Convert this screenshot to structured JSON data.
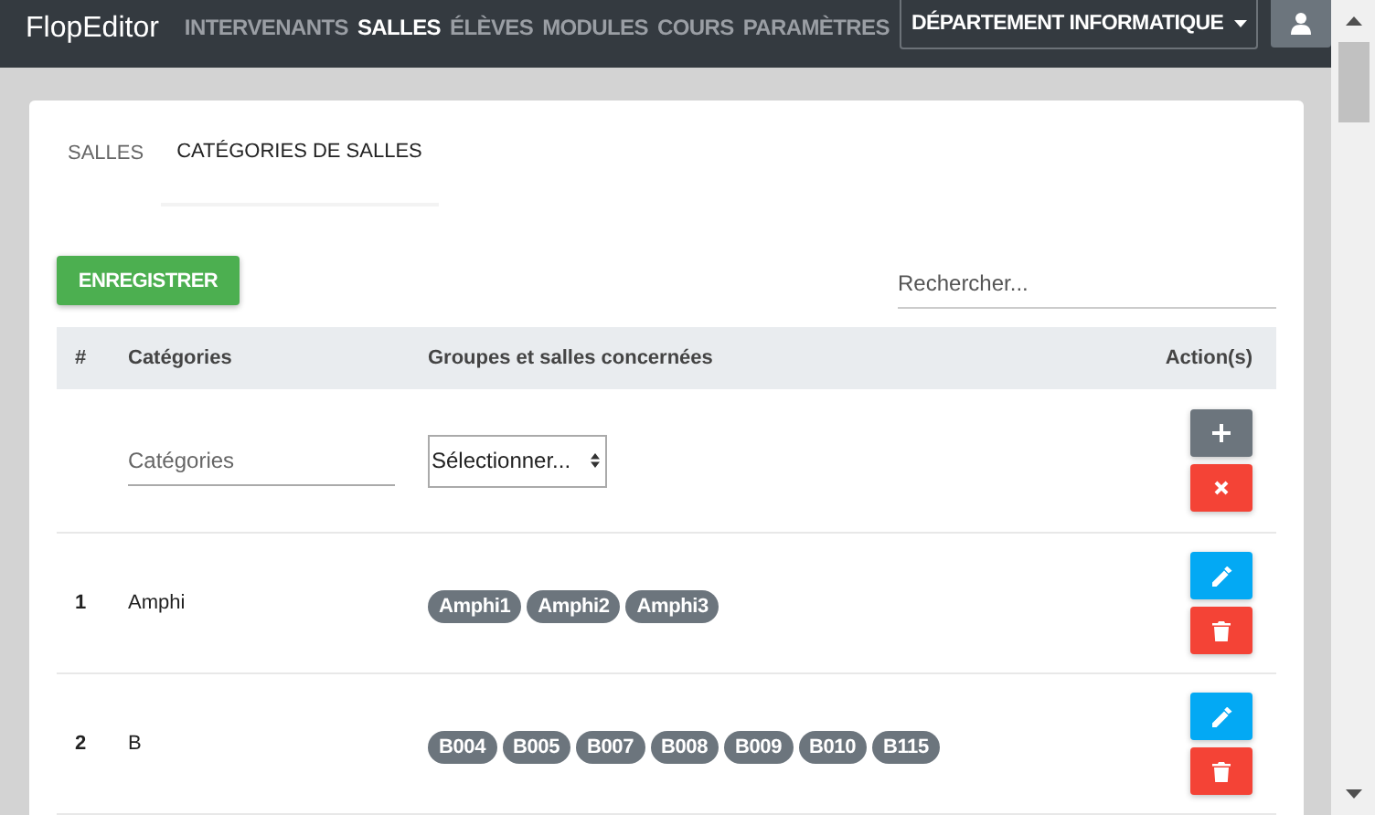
{
  "navbar": {
    "brand": "FlopEditor",
    "links": [
      {
        "label": "INTERVENANTS",
        "selected": false
      },
      {
        "label": "SALLES",
        "selected": true
      },
      {
        "label": "ÉLÈVES",
        "selected": false
      },
      {
        "label": "MODULES",
        "selected": false
      },
      {
        "label": "COURS",
        "selected": false
      },
      {
        "label": "PARAMÈTRES",
        "selected": false
      }
    ],
    "department": "DÉPARTEMENT INFORMATIQUE"
  },
  "tabs": [
    {
      "label": "SALLES",
      "selected": false
    },
    {
      "label": "CATÉGORIES DE SALLES",
      "selected": true
    }
  ],
  "save_button": "ENREGISTRER",
  "search": {
    "placeholder": "Rechercher..."
  },
  "table": {
    "columns": [
      "#",
      "Catégories",
      "Groupes et salles concernées",
      "Action(s)"
    ],
    "new_row": {
      "category_placeholder": "Catégories",
      "select_value": "Sélectionner..."
    },
    "rows": [
      {
        "index": "1",
        "category": "Amphi",
        "rooms": [
          "Amphi1",
          "Amphi2",
          "Amphi3"
        ]
      },
      {
        "index": "2",
        "category": "B",
        "rooms": [
          "B004",
          "B005",
          "B007",
          "B008",
          "B009",
          "B010",
          "B115"
        ]
      }
    ]
  }
}
